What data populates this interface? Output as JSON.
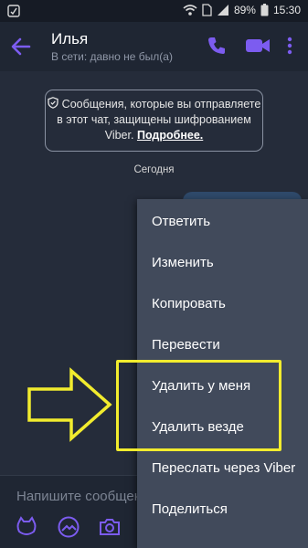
{
  "status_bar": {
    "battery_percent": "89%",
    "time": "15:30"
  },
  "header": {
    "contact_name": "Илья",
    "contact_status": "В сети: давно не был(а)"
  },
  "chat": {
    "encryption_notice": "Сообщения, которые вы отправляете в этот чат, защищены шифрованием Viber.",
    "encryption_link": "Подробнее.",
    "date_divider": "Сегодня"
  },
  "input": {
    "placeholder": "Напишите сообщение…"
  },
  "context_menu": {
    "items": [
      {
        "label": "Ответить"
      },
      {
        "label": "Изменить"
      },
      {
        "label": "Копировать"
      },
      {
        "label": "Перевести"
      },
      {
        "label": "Удалить у меня"
      },
      {
        "label": "Удалить везде"
      },
      {
        "label": "Переслать через Viber"
      },
      {
        "label": "Поделиться"
      }
    ]
  },
  "colors": {
    "accent": "#7c5cf0",
    "highlight": "#f2ec2e",
    "background": "#252c3a",
    "menu": "#414a5b"
  }
}
